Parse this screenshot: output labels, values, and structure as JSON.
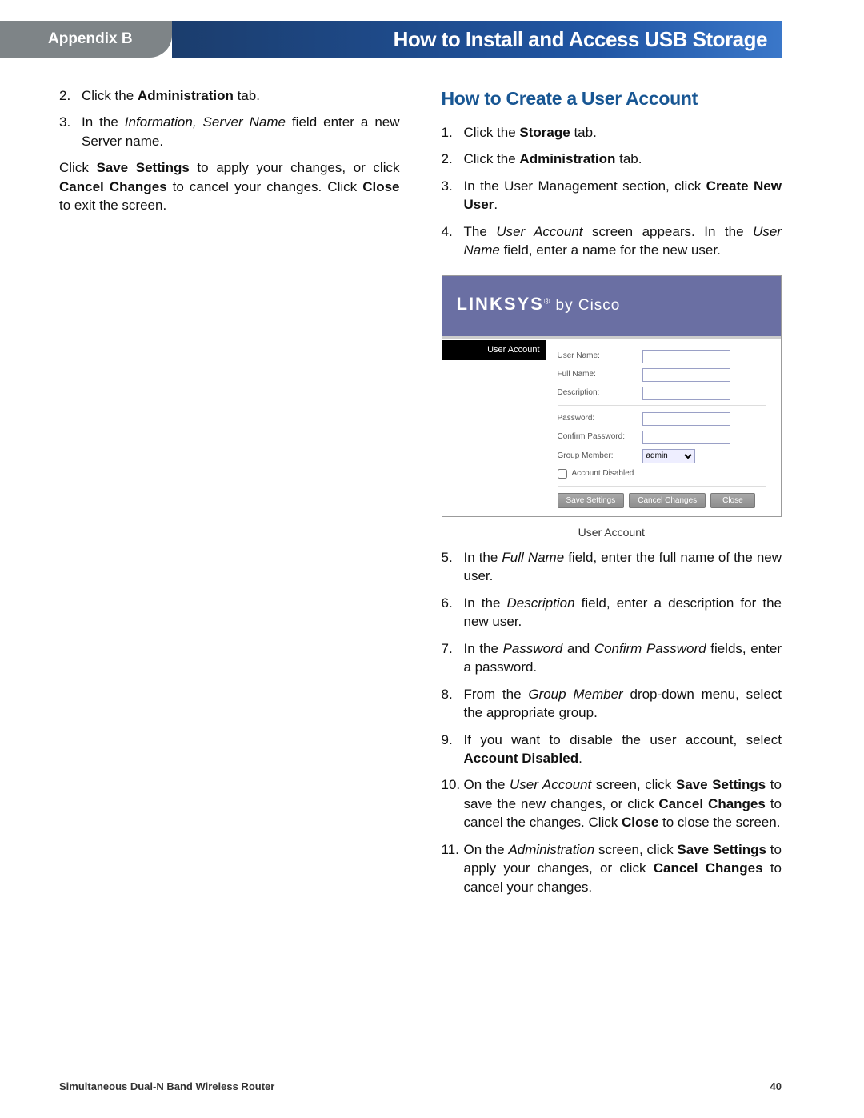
{
  "header": {
    "appendix_label": "Appendix B",
    "title": "How to Install and Access USB Storage"
  },
  "left_column": {
    "step2": "Click the <b>Administration</b> tab.",
    "step3": "In the <i>Information, Server Name</i> field enter a new Server name.",
    "closing": "Click <b>Save Settings</b> to apply your changes, or click <b>Cancel Changes</b> to cancel your changes. Click <b>Close</b> to exit the screen."
  },
  "right_column": {
    "heading": "How to Create a User Account",
    "steps_a": {
      "s1": "Click the <b>Storage</b> tab.",
      "s2": "Click the <b>Administration</b> tab.",
      "s3": "In the User Management section, click <b>Create New User</b>.",
      "s4": "The <i>User Account</i> screen appears. In the <i>User Name</i> field, enter a name for the new user."
    },
    "figure_caption": "User Account",
    "steps_b": {
      "s5": "In the <i>Full Name</i> field, enter the full name of the new user.",
      "s6": "In the <i>Description</i> field, enter a description for the new user.",
      "s7": "In the <i>Password</i> and <i>Confirm Password</i> fields, enter a password.",
      "s8": "From the <i>Group Member</i> drop-down menu, select the appropriate group.",
      "s9": "If you want to disable the user account, select <b>Account Disabled</b>.",
      "s10": "On the <i>User Account</i> screen, click <b>Save Settings</b> to save the new changes, or click <b>Cancel Changes</b> to cancel the changes. Click <b>Close</b> to close the screen.",
      "s11": "On the <i>Administration</i> screen, click <b>Save Settings</b> to apply your changes, or click <b>Cancel Changes</b> to cancel your changes."
    }
  },
  "ua_dialog": {
    "brand": "LINKSYS",
    "by": "by Cisco",
    "tab": "User Account",
    "labels": {
      "user_name": "User Name:",
      "full_name": "Full Name:",
      "description": "Description:",
      "password": "Password:",
      "confirm_password": "Confirm Password:",
      "group_member": "Group Member:",
      "account_disabled": "Account Disabled"
    },
    "group_value": "admin",
    "buttons": {
      "save": "Save Settings",
      "cancel": "Cancel Changes",
      "close": "Close"
    }
  },
  "footer": {
    "product": "Simultaneous Dual-N Band Wireless Router",
    "page": "40"
  }
}
